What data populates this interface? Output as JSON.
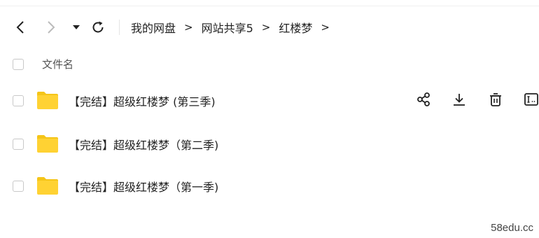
{
  "breadcrumb": {
    "items": [
      "我的网盘",
      "网站共享5",
      "红楼梦"
    ],
    "separator": ">"
  },
  "table": {
    "header_name": "文件名",
    "rows": [
      {
        "name": "【完结】超级红楼梦 (第三季)",
        "type": "folder",
        "hover": true
      },
      {
        "name": "【完结】超级红楼梦（第二季)",
        "type": "folder",
        "hover": false
      },
      {
        "name": "【完结】超级红楼梦（第一季)",
        "type": "folder",
        "hover": false
      }
    ]
  },
  "row_actions": [
    "share-icon",
    "download-icon",
    "delete-icon",
    "rename-icon"
  ],
  "icons": {
    "back": "chevron-left-icon",
    "forward": "chevron-right-icon",
    "history": "caret-down-icon",
    "refresh": "refresh-icon",
    "folder": "folder-icon"
  },
  "colors": {
    "folder": "#ffd233",
    "folder_tab": "#f5c518",
    "text": "#222222",
    "disabled": "#bbbbbb"
  },
  "watermark": "58edu.cc"
}
